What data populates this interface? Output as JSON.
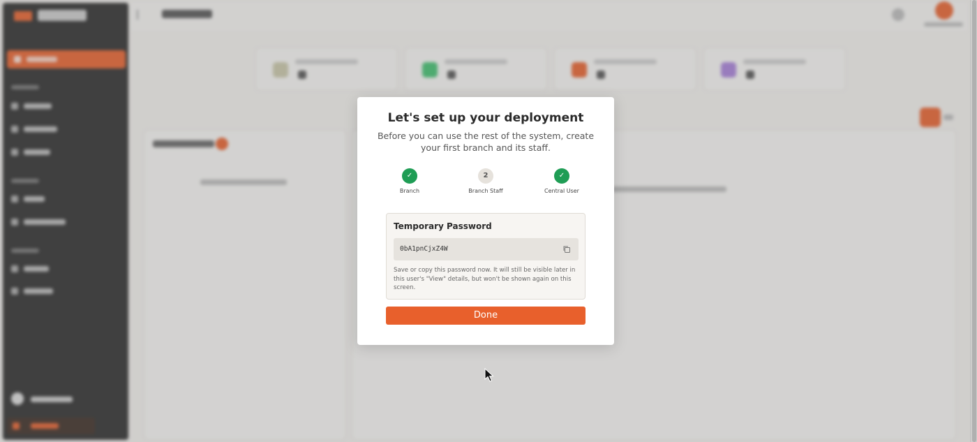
{
  "modal": {
    "title": "Let's set up your deployment",
    "subtitle": "Before you can use the rest of the system, create your first branch and its staff.",
    "steps": [
      {
        "label": "Branch",
        "marker": "✓",
        "status": "done"
      },
      {
        "label": "Branch Staff",
        "marker": "2",
        "status": "current"
      },
      {
        "label": "Central User",
        "marker": "✓",
        "status": "done"
      }
    ],
    "password": {
      "title": "Temporary Password",
      "value": "0bA1pnCjxZ4W",
      "note": "Save or copy this password now. It will still be visible later in this user's \"View\" details, but won't be shown again on this screen."
    },
    "done_label": "Done"
  },
  "colors": {
    "accent": "#e8602c",
    "success": "#1f9d55",
    "sidebar": "#2b2b2b"
  },
  "icons": {
    "copy": "copy-icon",
    "check": "check-icon",
    "cursor": "mouse-cursor-icon"
  }
}
